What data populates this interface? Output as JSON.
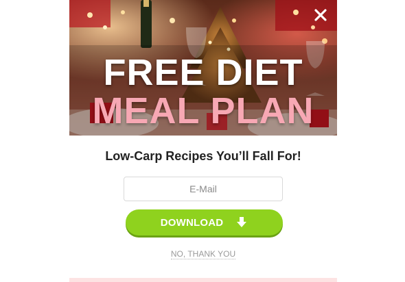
{
  "popup": {
    "hero": {
      "title_line1": "FREE DIET",
      "title_line2": "MEAL PLAN",
      "title_line1_color": "#ffffff",
      "title_line2_color": "#f7a8b4"
    },
    "close_icon": "close-icon",
    "tagline": "Low-Carp Recipes You’ll Fall For!",
    "email": {
      "placeholder": "E-Mail",
      "value": ""
    },
    "download_button": {
      "label": "DOWNLOAD",
      "icon": "download-arrow-icon",
      "color": "#8fd21e"
    },
    "decline_link": "NO, THANK YOU"
  }
}
